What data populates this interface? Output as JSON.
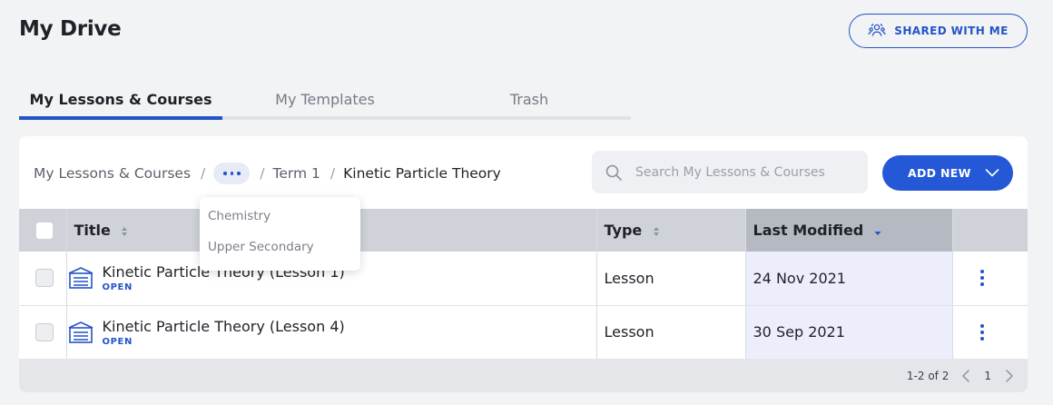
{
  "page": {
    "title": "My Drive"
  },
  "header": {
    "shared_label": "SHARED WITH ME"
  },
  "tabs": [
    {
      "label": "My Lessons & Courses",
      "active": true
    },
    {
      "label": "My Templates",
      "active": false
    },
    {
      "label": "Trash",
      "active": false
    }
  ],
  "breadcrumb": {
    "root": "My Lessons & Courses",
    "separator": "/",
    "term": "Term 1",
    "current": "Kinetic Particle Theory",
    "hidden_items": [
      "Chemistry",
      "Upper Secondary"
    ]
  },
  "search": {
    "placeholder": "Search My Lessons & Courses",
    "value": ""
  },
  "add_button": {
    "label": "ADD NEW"
  },
  "table": {
    "columns": {
      "title": "Title",
      "type": "Type",
      "modified": "Last Modified"
    },
    "sorted_column": "Last Modified",
    "sort_direction": "descending",
    "rows": [
      {
        "title": "Kinetic Particle Theory (Lesson 1)",
        "action": "OPEN",
        "type": "Lesson",
        "modified": "24 Nov 2021"
      },
      {
        "title": "Kinetic Particle Theory (Lesson 4)",
        "action": "OPEN",
        "type": "Lesson",
        "modified": "30 Sep 2021"
      }
    ]
  },
  "pagination": {
    "range": "1-2 of 2",
    "page": "1"
  },
  "icons": {
    "shared": "people-share-icon",
    "search": "search-icon",
    "add_dropdown": "chevron-down-icon",
    "lesson": "lesson-icon",
    "row_menu": "more-vertical-icon"
  },
  "colors": {
    "accent": "#2454c9",
    "sorted_header": "#b5bac2",
    "sorted_column": "#eceffb"
  }
}
